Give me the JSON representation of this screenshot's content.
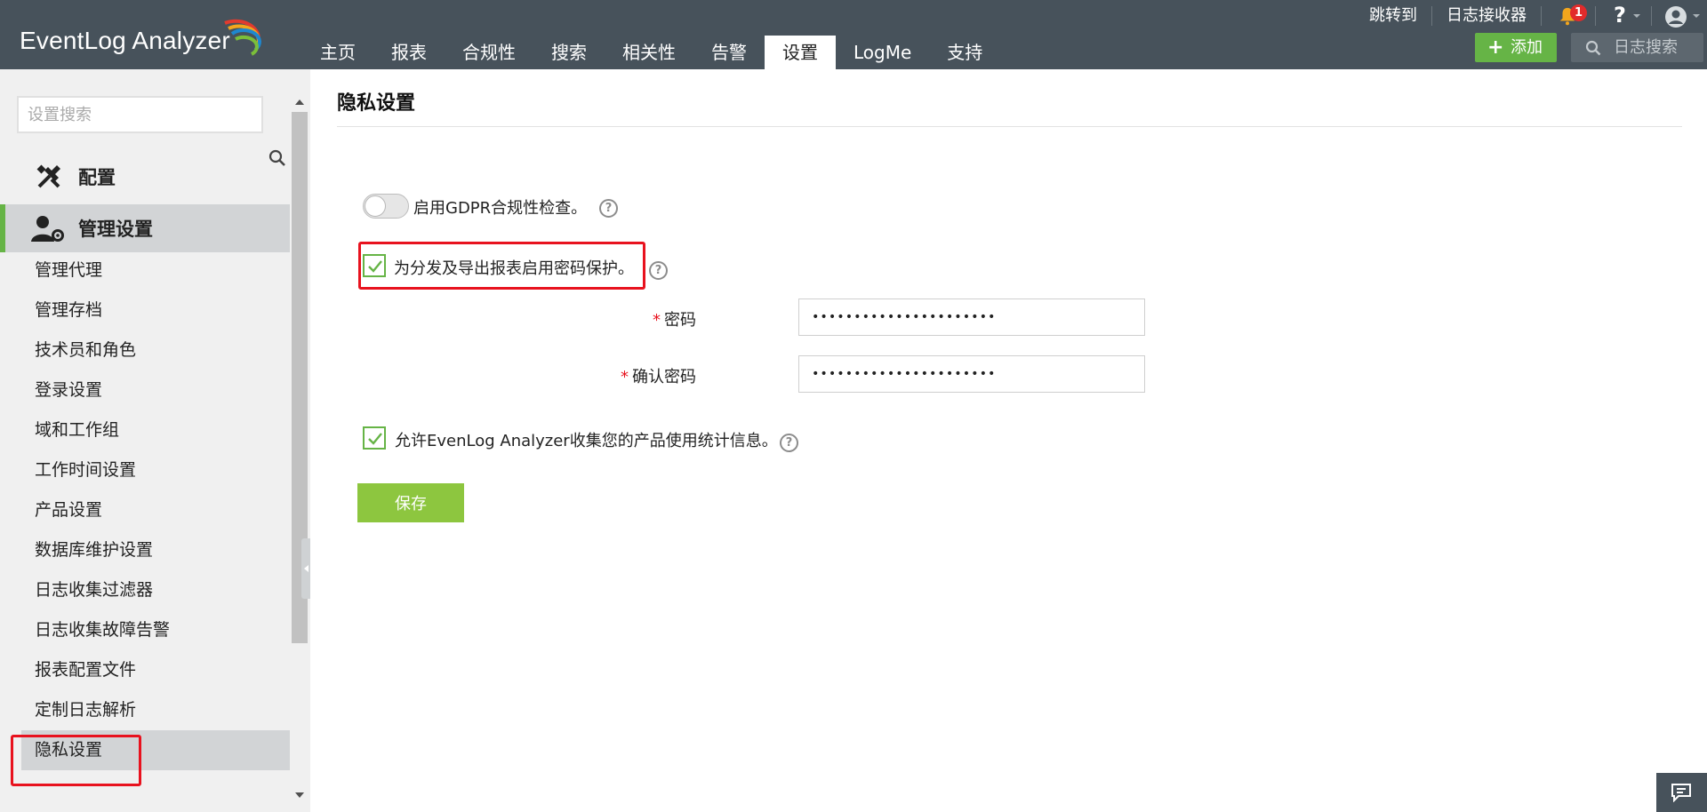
{
  "app": {
    "logo_text": "EventLog Analyzer"
  },
  "nav": {
    "tabs": [
      {
        "label": "主页"
      },
      {
        "label": "报表"
      },
      {
        "label": "合规性"
      },
      {
        "label": "搜索"
      },
      {
        "label": "相关性"
      },
      {
        "label": "告警"
      },
      {
        "label": "设置",
        "active": true
      },
      {
        "label": "LogMe"
      },
      {
        "label": "支持"
      }
    ]
  },
  "header": {
    "jump_to": "跳转到",
    "log_receiver": "日志接收器",
    "notification_count": "1",
    "help_symbol": "?",
    "add_button": "添加",
    "add_symbol": "+",
    "log_search_placeholder": "日志搜索"
  },
  "sidebar": {
    "search_placeholder": "设置搜索",
    "sections": {
      "config": "配置",
      "admin": "管理设置"
    },
    "items": [
      {
        "label": "管理代理"
      },
      {
        "label": "管理存档"
      },
      {
        "label": "技术员和角色"
      },
      {
        "label": "登录设置"
      },
      {
        "label": "域和工作组"
      },
      {
        "label": "工作时间设置"
      },
      {
        "label": "产品设置"
      },
      {
        "label": "数据库维护设置"
      },
      {
        "label": "日志收集过滤器"
      },
      {
        "label": "日志收集故障告警"
      },
      {
        "label": "报表配置文件"
      },
      {
        "label": "定制日志解析"
      },
      {
        "label": "隐私设置",
        "active": true
      }
    ]
  },
  "main": {
    "title": "隐私设置",
    "gdpr_label": "启用GDPR合规性检查。",
    "gdpr_enabled": false,
    "password_protect_label": "为分发及导出报表启用密码保护。",
    "password_protect_checked": true,
    "password_label": "密码",
    "password_value": "••••••••••••••••••••••",
    "confirm_label": "确认密码",
    "confirm_value": "••••••••••••••••••••••",
    "required_mark": "*",
    "usage_stats_label": "允许EvenLog Analyzer收集您的产品使用统计信息。",
    "usage_stats_checked": true,
    "help_symbol": "?",
    "save_button": "保存"
  },
  "colors": {
    "topbar": "#47525b",
    "accent_green": "#66b446",
    "save_green": "#8dc63f",
    "highlight_red": "#e8121e",
    "badge_red": "#e22b2b"
  },
  "icons": [
    "logo-swoosh-icon",
    "bell-icon",
    "help-icon",
    "user-icon",
    "search-icon",
    "tools-icon",
    "admin-user-icon",
    "check-icon",
    "chat-icon"
  ]
}
